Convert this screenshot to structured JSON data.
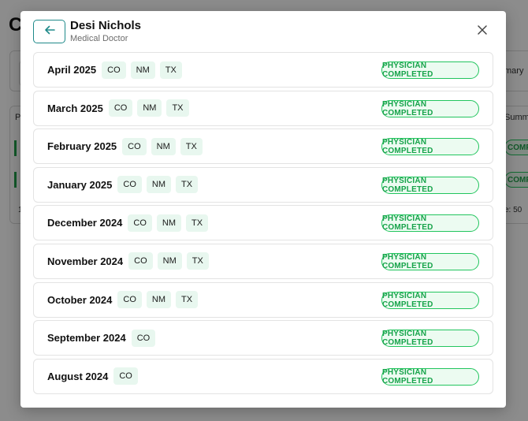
{
  "background": {
    "title_initial": "C",
    "summary_header": "mary",
    "table_col_left": "P",
    "table_col_right": "Summa",
    "comp_badges": [
      "COMP",
      "COMP"
    ],
    "footer_left": "1",
    "footer_right": "e:   50"
  },
  "modal": {
    "name": "Desi Nichols",
    "role": "Medical Doctor",
    "icons": {
      "back": "arrow-left-icon",
      "close": "close-icon"
    },
    "accent_color": "#1f8a8a",
    "status_color": "#16a34a",
    "rows": [
      {
        "month": "April 2025",
        "states": [
          "CO",
          "NM",
          "TX"
        ],
        "status": "PHYSICIAN COMPLETED"
      },
      {
        "month": "March 2025",
        "states": [
          "CO",
          "NM",
          "TX"
        ],
        "status": "PHYSICIAN COMPLETED"
      },
      {
        "month": "February 2025",
        "states": [
          "CO",
          "NM",
          "TX"
        ],
        "status": "PHYSICIAN COMPLETED"
      },
      {
        "month": "January 2025",
        "states": [
          "CO",
          "NM",
          "TX"
        ],
        "status": "PHYSICIAN COMPLETED"
      },
      {
        "month": "December 2024",
        "states": [
          "CO",
          "NM",
          "TX"
        ],
        "status": "PHYSICIAN COMPLETED"
      },
      {
        "month": "November 2024",
        "states": [
          "CO",
          "NM",
          "TX"
        ],
        "status": "PHYSICIAN COMPLETED"
      },
      {
        "month": "October 2024",
        "states": [
          "CO",
          "NM",
          "TX"
        ],
        "status": "PHYSICIAN COMPLETED"
      },
      {
        "month": "September 2024",
        "states": [
          "CO"
        ],
        "status": "PHYSICIAN COMPLETED"
      },
      {
        "month": "August 2024",
        "states": [
          "CO"
        ],
        "status": "PHYSICIAN COMPLETED"
      }
    ]
  }
}
